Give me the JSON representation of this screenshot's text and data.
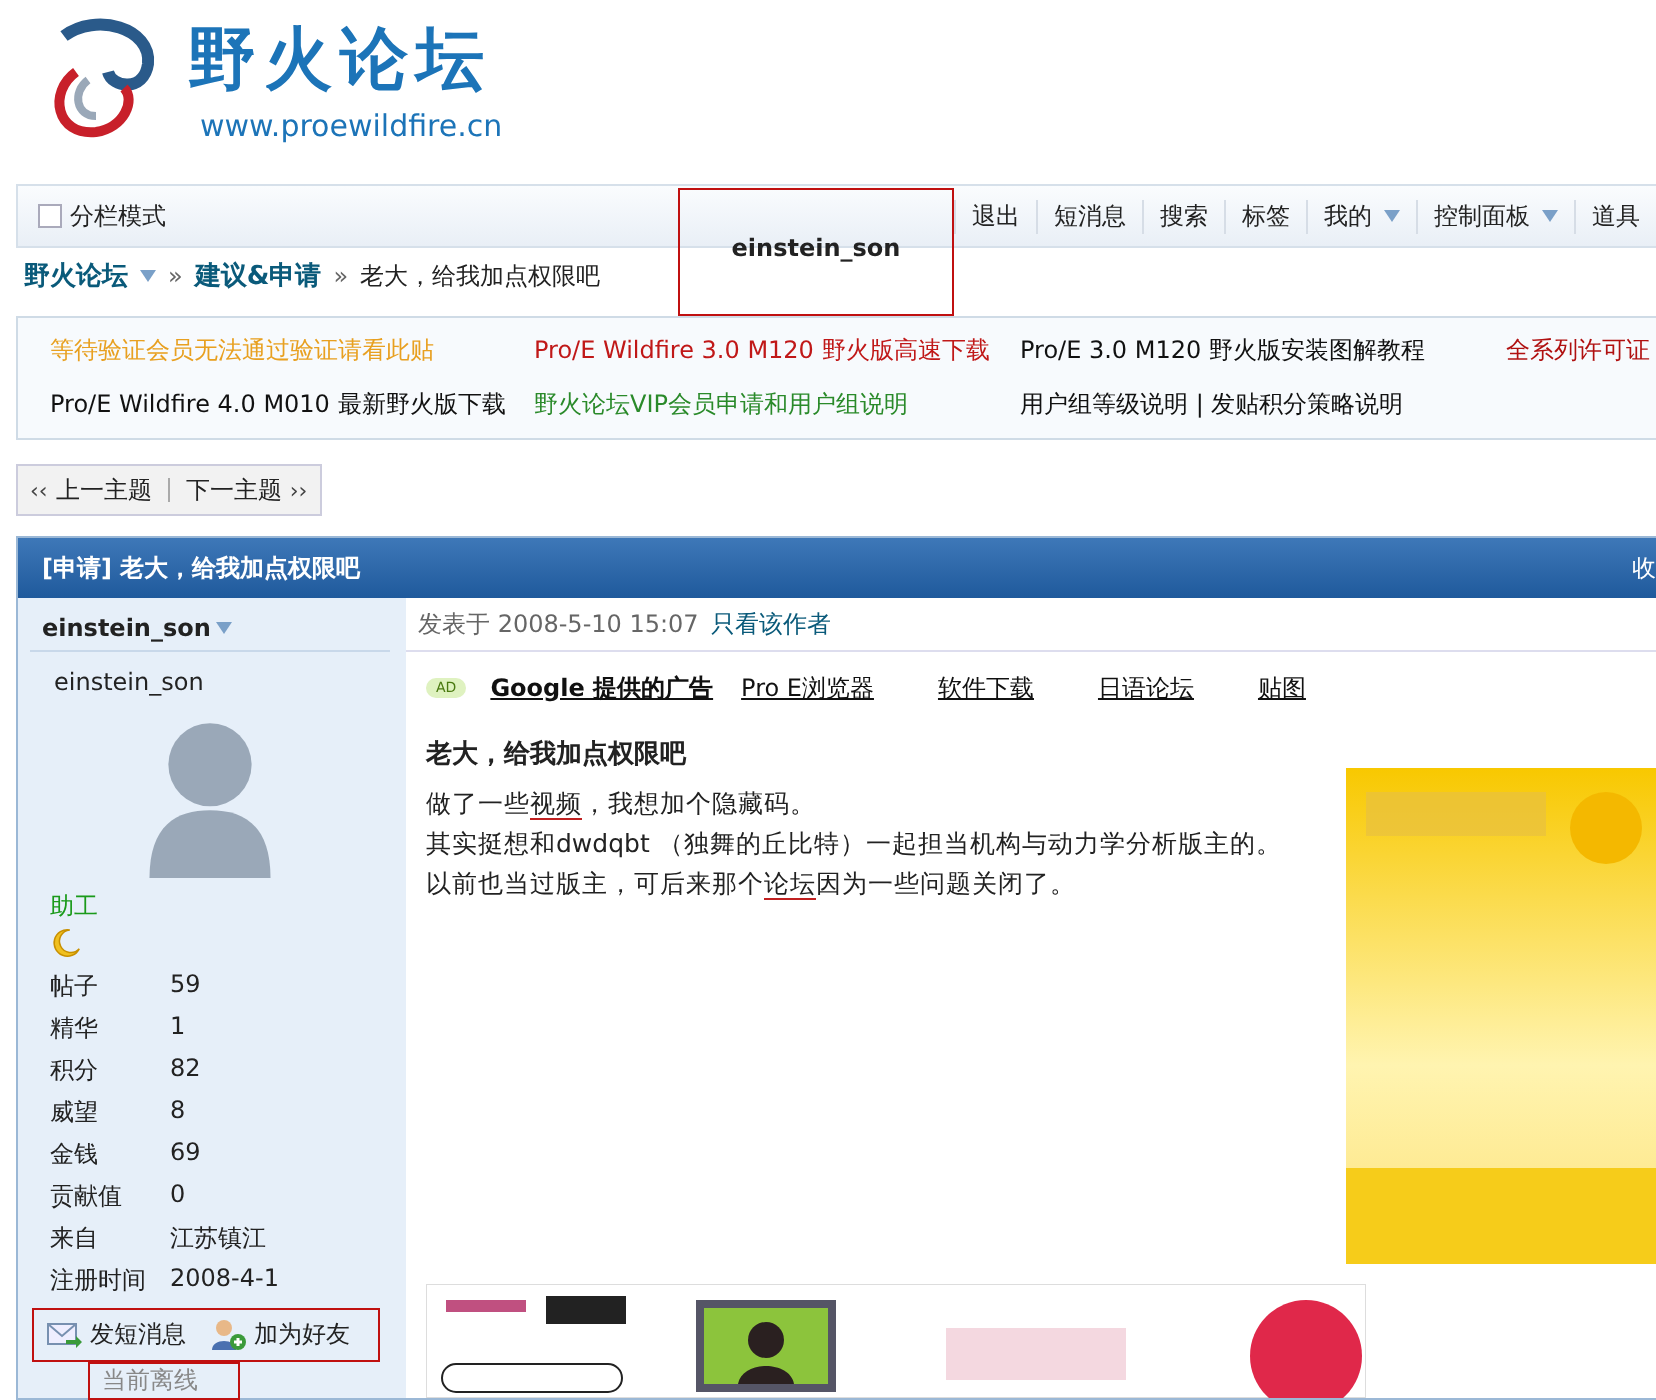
{
  "header": {
    "site_title": "野火论坛",
    "site_url": "www.proewildfire.cn"
  },
  "nav": {
    "split_mode": {
      "label": "分栏模式",
      "checked": false
    },
    "username": {
      "label": "einstein_son",
      "highlighted": true
    },
    "items": [
      {
        "label": "退出",
        "dropdown": false
      },
      {
        "label": "短消息",
        "dropdown": false
      },
      {
        "label": "搜索",
        "dropdown": false
      },
      {
        "label": "标签",
        "dropdown": false
      },
      {
        "label": "我的",
        "dropdown": true
      },
      {
        "label": "控制面板",
        "dropdown": true
      },
      {
        "label": "道具",
        "dropdown": false
      }
    ]
  },
  "breadcrumb": [
    {
      "label": "野火论坛",
      "kind": "forum"
    },
    {
      "label": "建议&申请",
      "kind": "board",
      "separator": "»"
    },
    {
      "label": "老大，给我加点权限吧",
      "kind": "current",
      "separator": "»"
    }
  ],
  "notices": [
    [
      {
        "label": "等待验证会员无法通过验证请看此贴",
        "color": "#e8a020"
      },
      {
        "label": "Pro/E Wildfire 3.0 M120 野火版高速下载",
        "color": "#c01818"
      },
      {
        "label": "Pro/E 3.0 M120 野火版安装图解教程",
        "color": "#111111"
      },
      {
        "label": "全系列许可证",
        "color": "#b01010"
      }
    ],
    [
      {
        "label": "Pro/E Wildfire 4.0 M010 最新野火版下载",
        "color": "#111111"
      },
      {
        "label": "野火论坛VIP会员申请和用户组说明",
        "color": "#2a8a2a"
      },
      {
        "label": "用户组等级说明 | 发贴积分策略说明",
        "color": "#111111"
      }
    ]
  ],
  "thread_nav": {
    "prev": "上一主题",
    "next": "下一主题",
    "prev_arrow": "‹‹",
    "next_arrow": "››"
  },
  "post_header": {
    "title": "[申请] 老大，给我加点权限吧",
    "right": "收"
  },
  "author": {
    "name": "einstein_son",
    "username": "einstein_son",
    "rank": "助工",
    "stats": [
      {
        "label": "帖子",
        "value": "59"
      },
      {
        "label": "精华",
        "value": "1"
      },
      {
        "label": "积分",
        "value": "82"
      },
      {
        "label": "威望",
        "value": "8"
      },
      {
        "label": "金钱",
        "value": "69"
      },
      {
        "label": "贡献值",
        "value": "0"
      },
      {
        "label": "来自",
        "value": "江苏镇江"
      },
      {
        "label": "注册时间",
        "value": "2008-4-1"
      }
    ],
    "actions": {
      "highlighted": true,
      "items": [
        {
          "label": "发短消息",
          "kind": "message"
        },
        {
          "label": "加为好友",
          "kind": "friend"
        }
      ]
    },
    "status": {
      "label": "当前离线",
      "highlighted": true
    }
  },
  "post": {
    "posted_label": "发表于",
    "posted_time": "2008-5-10 15:07",
    "author_only": "只看该作者",
    "ad_badge": "AD",
    "ad_links": [
      {
        "label": "Google 提供的广告",
        "kind": "title"
      },
      {
        "label": "Pro E浏览器",
        "kind": "link"
      },
      {
        "label": "软件下载",
        "kind": "link"
      },
      {
        "label": "日语论坛",
        "kind": "link"
      },
      {
        "label": "贴图",
        "kind": "link"
      }
    ],
    "title": "老大，给我加点权限吧",
    "paragraphs": [
      [
        {
          "text": "做了一些",
          "underlined": false
        },
        {
          "text": "视频",
          "underlined": true
        },
        {
          "text": "，我想加个隐藏码。",
          "underlined": false
        }
      ],
      [
        {
          "text": "其实挺想和dwdqbt （独舞的丘比特）一起担当机构与动力学分析版主的。以前也当过版主，可后来那个",
          "underlined": false
        },
        {
          "text": "论坛",
          "underlined": true
        },
        {
          "text": "因为一些问题关闭了。",
          "underlined": false
        }
      ]
    ],
    "side_ad": {
      "kind": "picture"
    },
    "banner": {
      "kind": "picture"
    }
  }
}
